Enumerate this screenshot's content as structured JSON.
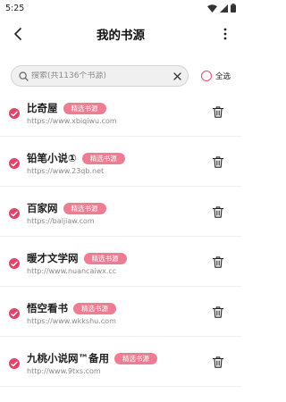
{
  "status_bar": {
    "time": "5:25",
    "icons": [
      "wifi-icon",
      "signal-icon",
      "battery-icon"
    ]
  },
  "header": {
    "title": "我的书源",
    "back_icon": "chevron-left-icon",
    "more_icon": "more-vertical-icon"
  },
  "search": {
    "placeholder": "搜索(共1136个书源)",
    "value": "",
    "search_icon": "search-icon",
    "clear_icon": "close-icon"
  },
  "select_all": {
    "label": "全选",
    "checked": false
  },
  "colors": {
    "accent": "#e2416a",
    "badge": "#ee7c93"
  },
  "sources": [
    {
      "name": "比奇屋",
      "badge": "精选书源",
      "url": "https://www.xbiqiwu.com",
      "checked": true
    },
    {
      "name": "铅笔小说①",
      "badge": "精选书源",
      "url": "https://www.23qb.net",
      "checked": true
    },
    {
      "name": "百家网",
      "badge": "精选书源",
      "url": "https://baijiaw.com",
      "checked": true
    },
    {
      "name": "暖才文学网",
      "badge": "精选书源",
      "url": "http://www.nuancaiwx.cc",
      "checked": true
    },
    {
      "name": "悟空看书",
      "badge": "精选书源",
      "url": "https://www.wkkshu.com",
      "checked": true
    },
    {
      "name": "九桃小说网™备用",
      "badge": "精选书源",
      "url": "http://www.9txs.com",
      "checked": true
    }
  ]
}
